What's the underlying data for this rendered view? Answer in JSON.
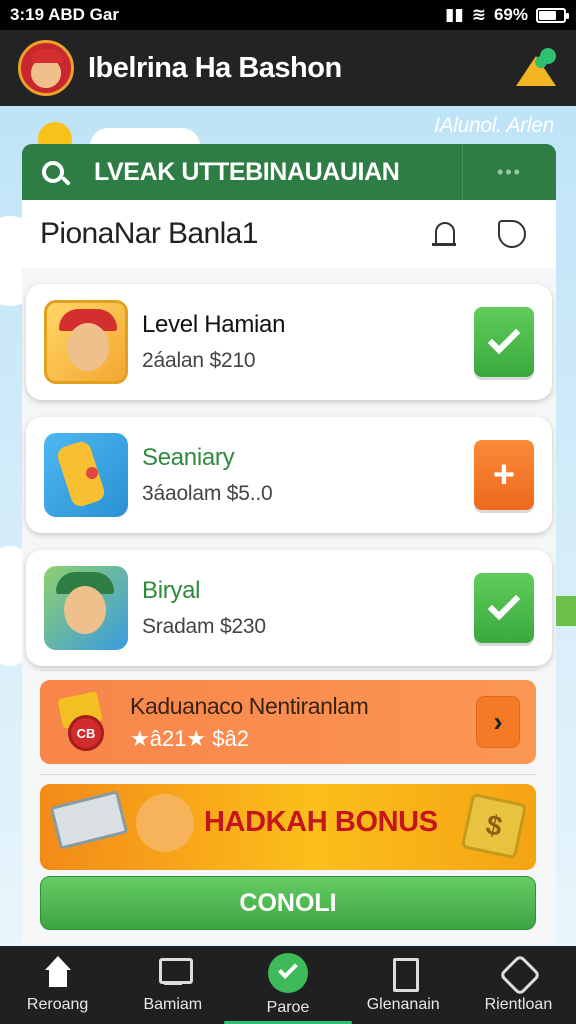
{
  "status": {
    "time": "3:19 ABD Gar",
    "battery": "69%",
    "battery_fraction": 0.69
  },
  "header": {
    "title": "Ibelrina Ha Bashon"
  },
  "sky": {
    "label": "IAlunol. Arlen"
  },
  "search": {
    "text": "LVEAK UTTEBINAUAUIAN",
    "dots": "•••"
  },
  "section": {
    "title": "PionaNar Banla1"
  },
  "items": [
    {
      "name": "Level Hamian",
      "price": "2áalan $210",
      "action": "check"
    },
    {
      "name": "Seaniary",
      "price": "3áaolam $5..0",
      "action": "add"
    },
    {
      "name": "Biryal",
      "price": "Sradam $230",
      "action": "check"
    }
  ],
  "promo": {
    "title": "Kaduanaco Nentiranlam",
    "subtitle": "★â21★ $â2",
    "arrow": "›",
    "badge": "CB"
  },
  "bonus": {
    "text": "HADKAH BONUS",
    "box_symbol": "$"
  },
  "continue": {
    "label": "CONOLI"
  },
  "nav": [
    {
      "label": "Reroang",
      "icon": "home-icon"
    },
    {
      "label": "Bamiam",
      "icon": "monitor-icon"
    },
    {
      "label": "Paroe",
      "icon": "check-icon"
    },
    {
      "label": "Glenanain",
      "icon": "document-icon"
    },
    {
      "label": "Rientloan",
      "icon": "badge-icon"
    }
  ]
}
